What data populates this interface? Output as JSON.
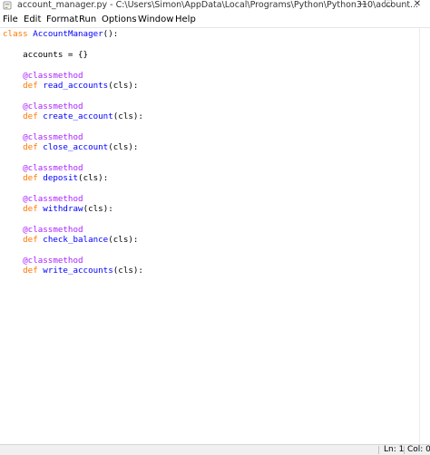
{
  "window": {
    "title": "account_manager.py - C:\\Users\\Simon\\AppData\\Local\\Programs\\Python\\Python310\\account...",
    "minimize": "—",
    "maximize": "☐",
    "close": "✕"
  },
  "menu": {
    "items": [
      "File",
      "Edit",
      "Format",
      "Run",
      "Options",
      "Window",
      "Help"
    ]
  },
  "code": {
    "l1_kw": "class",
    "l1_name": "AccountManager",
    "l1_rest": "():",
    "l2": "accounts = {}",
    "deco": "@classmethod",
    "def_kw": "def",
    "methods": [
      {
        "name": "read_accounts",
        "args": "(cls):"
      },
      {
        "name": "create_account",
        "args": "(cls):"
      },
      {
        "name": "close_account",
        "args": "(cls):"
      },
      {
        "name": "deposit",
        "args": "(cls):"
      },
      {
        "name": "withdraw",
        "args": "(cls):"
      },
      {
        "name": "check_balance",
        "args": "(cls):"
      },
      {
        "name": "write_accounts",
        "args": "(cls):"
      }
    ]
  },
  "status": {
    "line": "Ln: 1",
    "col": "Col: 0"
  },
  "colors": {
    "keyword": "#ff7700",
    "decorator": "#aa22ff",
    "definition": "#0000ff",
    "text": "#000000"
  }
}
